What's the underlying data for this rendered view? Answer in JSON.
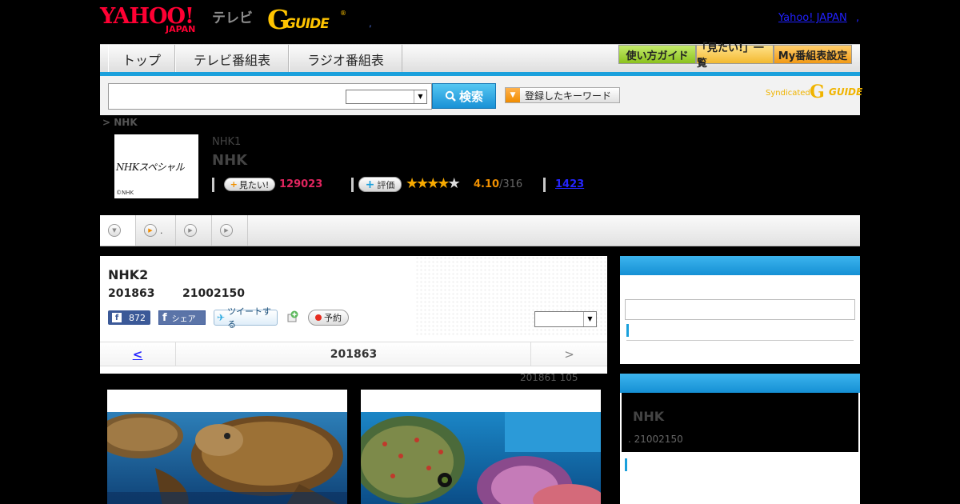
{
  "header": {
    "yahoo_logo": "YAHOO!",
    "yahoo_sub": "JAPAN",
    "tv_label": "テレビ",
    "gguide_logo": "G",
    "gguide_text": "GUIDE",
    "gguide_reg": "®",
    "comma": ",",
    "top_link": "Yahoo! JAPAN",
    "top_comma": ","
  },
  "nav": {
    "tabs": [
      "トップ",
      "テレビ番組表",
      "ラジオ番組表"
    ],
    "buttons": [
      {
        "label": "使い方ガイド",
        "color": "#9ad13c"
      },
      {
        "label": "「見たい!」一覧",
        "color": "#f7c547"
      },
      {
        "label": "My番組表設定",
        "color": "#f5a623"
      }
    ],
    "strip_color": "#1aa0dc"
  },
  "search": {
    "input_value": "",
    "select_value": "",
    "button_label": "検索",
    "keyword_button": "登録したキーワード",
    "syndicated": "Syndicated",
    "syndicated_logo": "G",
    "syndicated_logo_text": "GUIDE"
  },
  "program": {
    "breadcrumb": "> NHK",
    "thumb_text": "NHKスペシャル",
    "thumb_credit": "©NHK",
    "channel": "NHK1",
    "title": "NHK",
    "want_button": "見たい!",
    "want_count": "129023",
    "eval_button": "評価",
    "rating": "4.10",
    "rating_count": "/316",
    "stars_filled": 4,
    "review_count": "1423"
  },
  "tabs": [
    {
      "icon": "down-arrow-icon",
      "label": ""
    },
    {
      "icon": "play-icon",
      "label": "."
    },
    {
      "icon": "play-icon",
      "label": ""
    },
    {
      "icon": "play-icon",
      "label": ""
    }
  ],
  "main": {
    "title": "NHK2",
    "date": "201863",
    "time": "21002150",
    "fb_count": "872",
    "fb_share": "シェア",
    "tweet": "ツイートする",
    "reserve": "予約",
    "select_value": "",
    "prev": "<",
    "current_date": "201863",
    "next": ">",
    "info_line": "201861  105"
  },
  "sidebar": {
    "box2_title": "NHK",
    "box2_sub": ". 21002150"
  }
}
